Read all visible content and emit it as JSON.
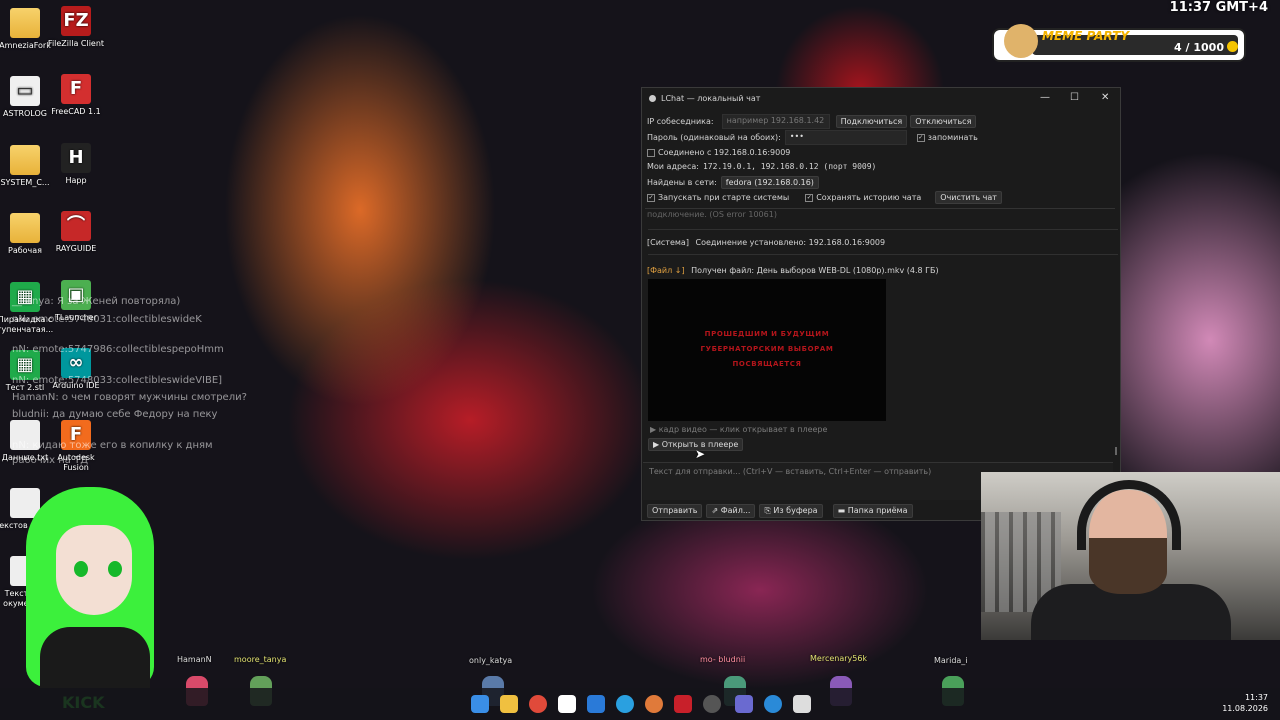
{
  "desktop_icons": [
    {
      "label": "AmneziaFork",
      "icon": "folder-icon"
    },
    {
      "label": "FileZilla Client",
      "icon": "filezilla-icon"
    },
    {
      "label": "ASTROLOG",
      "icon": "folder-icon"
    },
    {
      "label": "FreeCAD 1.1",
      "icon": "freecad-icon"
    },
    {
      "label": "SYSTEM_C...",
      "icon": "folder-icon"
    },
    {
      "label": "Happ",
      "icon": "happ-icon"
    },
    {
      "label": "Рабочая",
      "icon": "folder-icon"
    },
    {
      "label": "RAYGUIDE",
      "icon": "rayguide-icon"
    },
    {
      "label": "Пирамидка с тупенчатая...",
      "icon": "spreadsheet-icon"
    },
    {
      "label": "TLauncher",
      "icon": "minecraft-icon"
    },
    {
      "label": "Тест 2.stl",
      "icon": "spreadsheet-icon"
    },
    {
      "label": "Arduino IDE",
      "icon": "arduino-icon"
    },
    {
      "label": "Данные.txt",
      "icon": "document-icon"
    },
    {
      "label": "Autodesk Fusion",
      "icon": "fusion-icon"
    },
    {
      "label": "Текстов окуме",
      "icon": "document-icon"
    },
    {
      "label": "Текстов а окумет.txt",
      "icon": "document-icon"
    }
  ],
  "top_clock": "11:37 GMT+4",
  "meme_party": {
    "title": "MEME PARTY",
    "score": "4 / 1000"
  },
  "window": {
    "title": "LChat — локальный чат",
    "ip_label": "IP собеседника:",
    "ip_placeholder": "например 192.168.1.42",
    "connect": "Подключиться",
    "disconnect": "Отключиться",
    "password_label": "Пароль (одинаковый на обоих):",
    "password_value": "•••",
    "remember": "запоминать",
    "status": "Соединено с 192.168.0.16:9009",
    "my_addr_label": "Мои адреса:",
    "my_addr_value": "172.19.0.1, 192.168.0.12  (порт 9009)",
    "found_label": "Найдены в сети:",
    "found_peer": "fedora (192.168.0.16)",
    "autostart": "Запускать при старте системы",
    "save_history": "Сохранять историю чата",
    "clear_chat": "Очистить чат",
    "log_cut": "подключение. (OS error 10061)",
    "log_system_tag": "[Система]",
    "log_system_text": "Соединение установлено: 192.168.0.16:9009",
    "log_file_tag": "[Файл ↓]",
    "log_file_text": "Получен файл: День выборов WEB-DL (1080p).mkv (4.8 ГБ)",
    "video_text": [
      "ПРОШЕДШИМ И БУДУЩИМ",
      "ГУБЕРНАТОРСКИМ ВЫБОРАМ",
      "ПОСВЯЩАЕТСЯ"
    ],
    "video_caption": "▶ кадр видео — клик открывает в плеере",
    "open_player": "▶ Открыть в плеере",
    "compose_placeholder": "Текст для отправки... (Ctrl+V — вставить, Ctrl+Enter — отправить)",
    "send": "Отправить",
    "file": "⇗ Файл...",
    "from_clipboard": "⎘ Из буфера",
    "receive_folder": "▬ Папка приёма"
  },
  "stream_chat": [
    "__tanya: Я за Женей повторяла)",
    "nN: emote:5748031:collectibleswideK",
    "nN: emote:5747986:collectiblespepoHmm",
    "nN: emote:5748033:collectibleswideVIBE]",
    "HamanN: о чем говорят мужчины смотрели?",
    "bludnii: да думаю себе Федору на пеку",
    "nN: кидаю тоже его в копилку к дням",
    "рабочих на ТД"
  ],
  "nicknames": [
    "HamanN",
    "moore_tanya",
    "only_katya",
    "mo- bludnii",
    "Mercenary56k",
    "Marida_i"
  ],
  "tray": {
    "time": "11:37",
    "date": "11.08.2026"
  }
}
